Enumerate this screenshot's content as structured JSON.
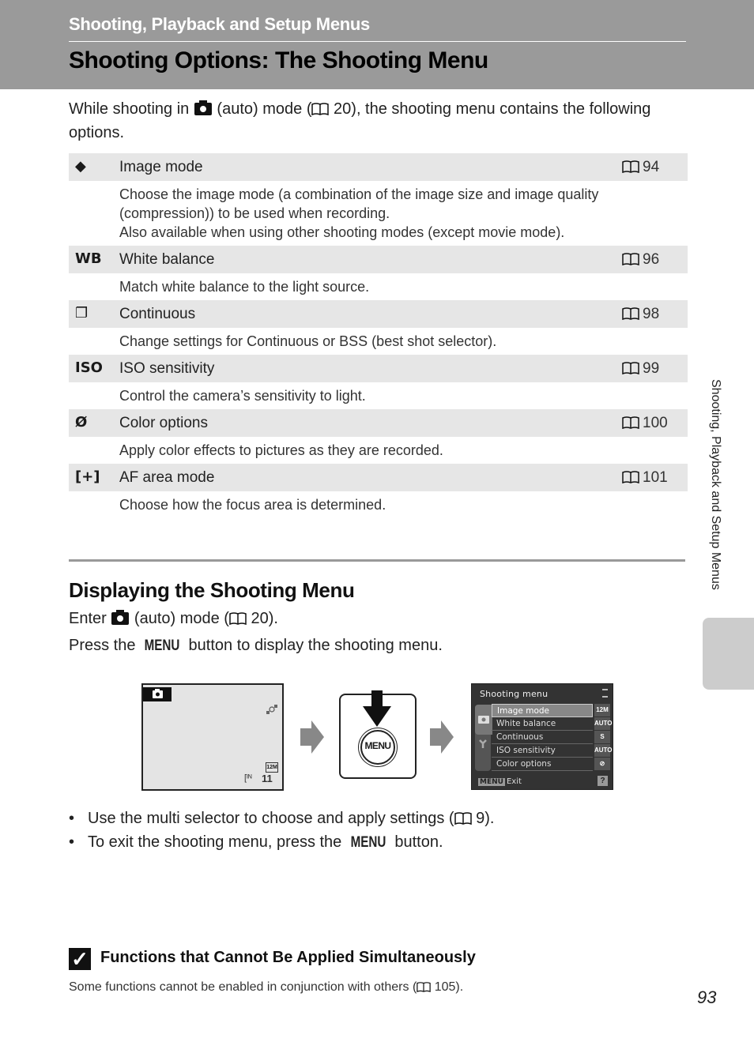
{
  "header": {
    "section": "Shooting, Playback and Setup Menus",
    "title": "Shooting Options: The Shooting Menu",
    "background_color": "#9a9a9a"
  },
  "intro": {
    "before_icon": "While shooting in ",
    "icon": "camera-auto-icon",
    "after_icon": " (auto) mode (",
    "ref": " 20), the shooting menu contains the following options."
  },
  "options": [
    {
      "icon": "image-mode-icon",
      "glyph": "◆",
      "label": "Image mode",
      "page": "94",
      "description": [
        "Choose the image mode (a combination of the image size and image quality (compression)) to be used when recording.",
        "Also available when using other shooting modes (except movie mode)."
      ]
    },
    {
      "icon": "white-balance-icon",
      "glyph": "WB",
      "label": "White balance",
      "page": "96",
      "description": [
        "Match white balance to the light source."
      ]
    },
    {
      "icon": "continuous-icon",
      "glyph": "❐",
      "label": "Continuous",
      "page": "98",
      "description": [
        "Change settings for Continuous or BSS (best shot selector)."
      ]
    },
    {
      "icon": "iso-sensitivity-icon",
      "glyph": "ISO",
      "label": "ISO sensitivity",
      "page": "99",
      "description": [
        "Control the camera’s sensitivity to light."
      ]
    },
    {
      "icon": "color-options-icon",
      "glyph": "Ø",
      "label": "Color options",
      "page": "100",
      "description": [
        "Apply color effects to pictures as they are recorded."
      ]
    },
    {
      "icon": "af-area-mode-icon",
      "glyph": "[+]",
      "label": "AF area mode",
      "page": "101",
      "description": [
        "Choose how the focus area is determined."
      ]
    }
  ],
  "displaying": {
    "title": "Displaying the Shooting Menu",
    "step1_a": "Enter ",
    "step1_b": " (auto) mode (",
    "step1_c": " 20).",
    "step2_a": "Press the ",
    "menu_word": "MENU",
    "step2_b": " button to display the shooting menu."
  },
  "illustration": {
    "screen1": {
      "remaining": "11",
      "image_size": "12M"
    },
    "menu_button_label": "MENU",
    "screen2": {
      "title": "Shooting menu",
      "items": [
        {
          "label": "Image mode",
          "value": "12M",
          "selected": true
        },
        {
          "label": "White balance",
          "value": "AUTO"
        },
        {
          "label": "Continuous",
          "value": "S"
        },
        {
          "label": "ISO sensitivity",
          "value": "AUTO"
        },
        {
          "label": "Color options",
          "value": "⊘"
        }
      ],
      "footer_key": "MENU",
      "footer_label": "Exit",
      "help": "?"
    }
  },
  "bullets": [
    {
      "a": "Use the multi selector to choose and apply settings (",
      "b": " 9)."
    },
    {
      "a": "To exit the shooting menu, press the ",
      "menu": "MENU",
      "b": " button."
    }
  ],
  "note": {
    "title": "Functions that Cannot Be Applied Simultaneously",
    "body_a": "Some functions cannot be enabled in conjunction with others (",
    "body_b": " 105)."
  },
  "side_tab": "Shooting, Playback and Setup Menus",
  "page_number": "93"
}
